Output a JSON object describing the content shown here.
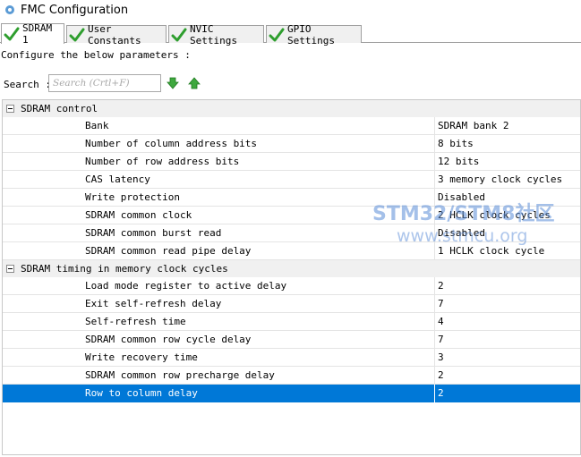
{
  "window": {
    "title": "FMC Configuration",
    "icon": "gear-icon"
  },
  "tabs": [
    {
      "label": "SDRAM 1",
      "active": true
    },
    {
      "label": "User Constants",
      "active": false
    },
    {
      "label": "NVIC Settings",
      "active": false
    },
    {
      "label": "GPIO Settings",
      "active": false
    }
  ],
  "instructions": "Configure the below parameters :",
  "search": {
    "label": "Search :",
    "placeholder": "Search (Crtl+F)"
  },
  "groups": [
    {
      "label": "SDRAM control",
      "rows": [
        {
          "name": "Bank",
          "value": "SDRAM bank 2"
        },
        {
          "name": "Number of column address bits",
          "value": "8 bits"
        },
        {
          "name": "Number of row address bits",
          "value": "12 bits"
        },
        {
          "name": "CAS latency",
          "value": "3 memory clock cycles"
        },
        {
          "name": "Write protection",
          "value": "Disabled"
        },
        {
          "name": "SDRAM common clock",
          "value": "2 HCLK clock cycles"
        },
        {
          "name": "SDRAM common burst read",
          "value": "Disabled"
        },
        {
          "name": "SDRAM common read pipe delay",
          "value": "1 HCLK clock cycle"
        }
      ]
    },
    {
      "label": "SDRAM timing in memory clock cycles",
      "rows": [
        {
          "name": "Load mode register to active delay",
          "value": "2"
        },
        {
          "name": "Exit self-refresh delay",
          "value": "7"
        },
        {
          "name": "Self-refresh time",
          "value": "4"
        },
        {
          "name": "SDRAM common row cycle delay",
          "value": "7"
        },
        {
          "name": "Write recovery time",
          "value": "3"
        },
        {
          "name": "SDRAM common row precharge delay",
          "value": "2"
        },
        {
          "name": "Row to column delay",
          "value": "2",
          "selected": true
        }
      ]
    }
  ],
  "watermark": {
    "line1": "STM32/STM8社区",
    "line2": "www.stmcu.org"
  },
  "colors": {
    "selection": "#0078d7",
    "check": "#2e9e2e",
    "group_bg": "#f0f0f0",
    "watermark": "#5a8cd7"
  }
}
